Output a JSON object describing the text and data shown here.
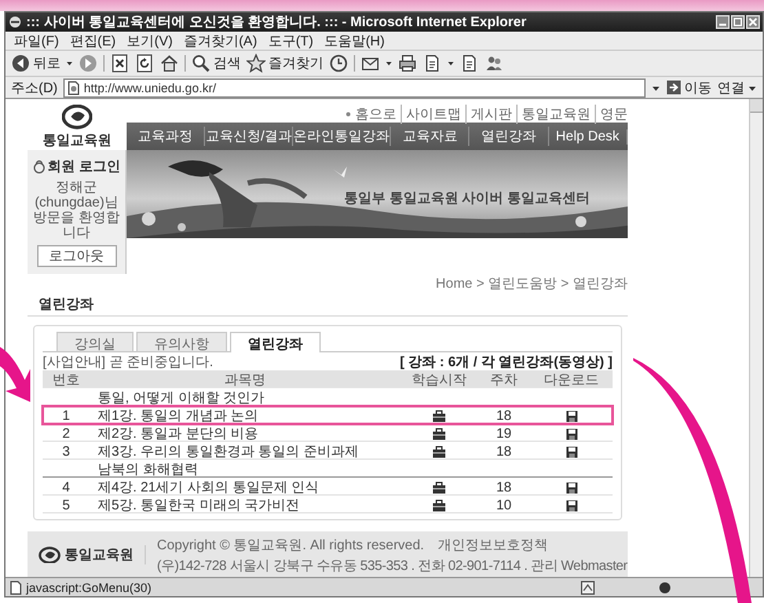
{
  "window": {
    "title": "::: 사이버 통일교육센터에 오신것을 환영합니다. ::: - Microsoft Internet Explorer"
  },
  "menu_bar": [
    "파일(F)",
    "편집(E)",
    "보기(V)",
    "즐겨찾기(A)",
    "도구(T)",
    "도움말(H)"
  ],
  "toolbar": {
    "back_label": "뒤로",
    "search_label": "검색",
    "favorites_label": "즐겨찾기"
  },
  "address_bar": {
    "label": "주소(D)",
    "url": "http://www.uniedu.go.kr/",
    "go_label": "이동",
    "links_label": "연결"
  },
  "site": {
    "top_links": [
      "홈으로",
      "사이트맵",
      "게시판",
      "통일교육원",
      "영문"
    ],
    "logo_text": "통일교육원",
    "nav": [
      "교육과정",
      "교육신청/결과",
      "온라인통일강좌",
      "교육자료",
      "열린강좌",
      "Help Desk"
    ],
    "login": {
      "title": "회원 로그인",
      "welcome": "정해군(chungdae)님 방문을 환영합니다",
      "button": "로그아웃"
    },
    "banner_text": "통일부 통일교육원 사이버 통일교육센터",
    "breadcrumb": "Home > 열린도움방 > 열린강좌",
    "page_title": "열린강좌",
    "tabs": [
      {
        "label": "강의실",
        "selected": false
      },
      {
        "label": "유의사항",
        "selected": false
      },
      {
        "label": "열린강좌",
        "selected": true
      }
    ],
    "notice": "[사업안내] 곧 준비중입니다.",
    "summary": "[ 강좌 : 6개 / 각 열린강좌(동영상) ]",
    "table": {
      "columns": [
        "번호",
        "과목명",
        "학습시작",
        "주차",
        "다운로드"
      ],
      "rows": [
        {
          "kind": "group",
          "title": "통일, 어떻게 이해할 것인가"
        },
        {
          "kind": "lecture",
          "number": "1",
          "title": "제1강. 통일의 개념과 논의",
          "week": "18",
          "highlighted": true
        },
        {
          "kind": "lecture",
          "number": "2",
          "title": "제2강. 통일과 분단의 비용",
          "week": "19",
          "highlighted": false
        },
        {
          "kind": "lecture",
          "number": "3",
          "title": "제3강. 우리의 통일환경과 통일의 준비과제",
          "week": "18",
          "highlighted": false
        },
        {
          "kind": "group",
          "title": "남북의 화해협력"
        },
        {
          "kind": "lecture",
          "number": "4",
          "title": "제4강. 21세기 사회의 통일문제 인식",
          "week": "18",
          "highlighted": false
        },
        {
          "kind": "lecture",
          "number": "5",
          "title": "제5강. 통일한국 미래의 국가비전",
          "week": "10",
          "highlighted": false
        }
      ]
    },
    "footer": {
      "logo_text": "통일교육원",
      "copyright": "Copyright © 통일교육원. All rights reserved.",
      "privacy_link": "개인정보보호정책",
      "address": "(우)142-728 서울시 강북구 수유동 535-353 . 전화 02-901-7114 . 관리 Webmaster"
    }
  },
  "status_bar": {
    "text": "javascript:GoMenu(30)"
  }
}
